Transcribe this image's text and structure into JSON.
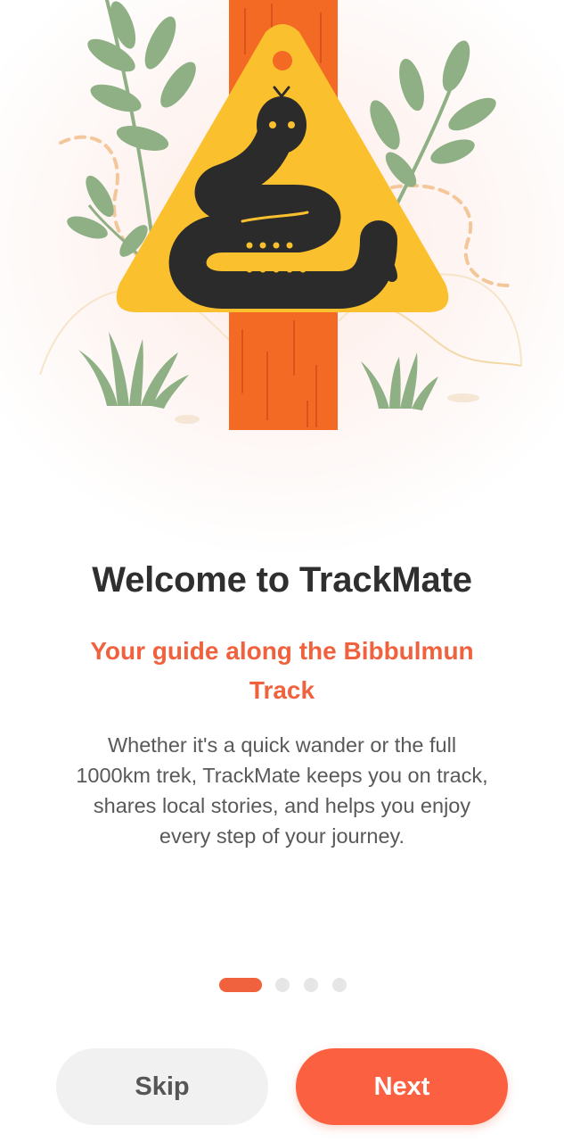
{
  "onboarding": {
    "title": "Welcome to TrackMate",
    "subtitle": "Your guide along the Bibbulmun Track",
    "description": "Whether it's a quick wander or the full 1000km trek, TrackMate keeps you on track, shares local stories, and helps you enjoy every step of your journey.",
    "illustration_icon": "snake-warning-sign-icon",
    "page_indicator": {
      "current": 1,
      "total": 4
    }
  },
  "actions": {
    "skip_label": "Skip",
    "next_label": "Next"
  },
  "colors": {
    "accent": "#f0623e",
    "title": "#2f2f2f",
    "body": "#595959",
    "sign_yellow": "#fbc02d",
    "post_orange": "#f26a24",
    "leaf_green": "#8fb085"
  }
}
